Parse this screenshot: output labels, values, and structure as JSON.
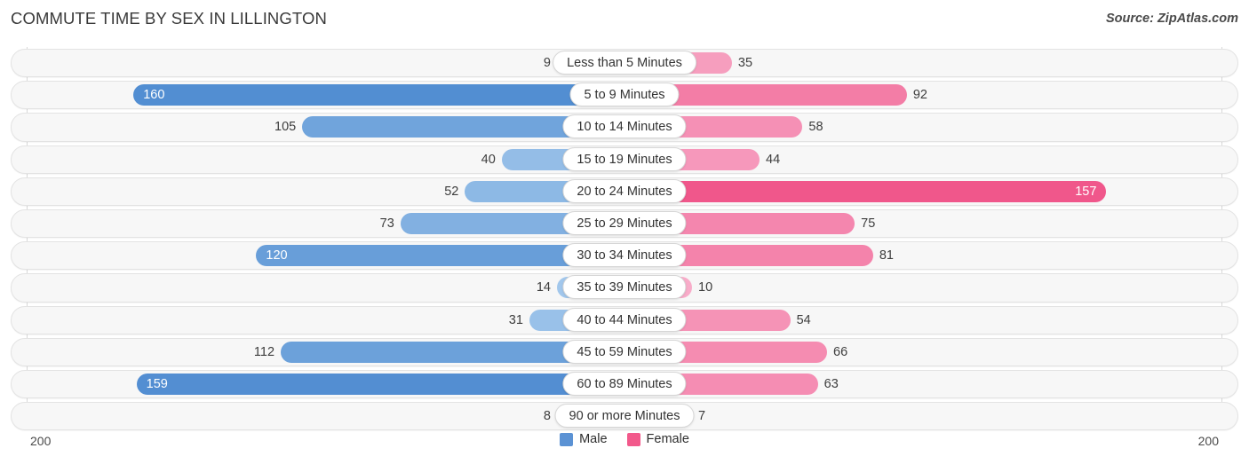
{
  "header": {
    "title": "COMMUTE TIME BY SEX IN LILLINGTON",
    "source": "Source: ZipAtlas.com"
  },
  "legend": {
    "items": [
      {
        "label": "Male",
        "color": "#5b92d4"
      },
      {
        "label": "Female",
        "color": "#f2598b"
      }
    ]
  },
  "axis": {
    "left_label": "200",
    "right_label": "200"
  },
  "chart_data": {
    "type": "bar",
    "title": "COMMUTE TIME BY SEX IN LILLINGTON",
    "subtitle": "Source: ZipAtlas.com",
    "orientation": "horizontal-diverging",
    "xlabel": "",
    "ylabel": "",
    "xlim": [
      200,
      200
    ],
    "axis_left_max": 200,
    "axis_right_max": 200,
    "grid": false,
    "legend_position": "bottom-center",
    "categories": [
      "Less than 5 Minutes",
      "5 to 9 Minutes",
      "10 to 14 Minutes",
      "15 to 19 Minutes",
      "20 to 24 Minutes",
      "25 to 29 Minutes",
      "30 to 34 Minutes",
      "35 to 39 Minutes",
      "40 to 44 Minutes",
      "45 to 59 Minutes",
      "60 to 89 Minutes",
      "90 or more Minutes"
    ],
    "series": [
      {
        "name": "Male",
        "color": "#5b92d4",
        "values": [
          9,
          160,
          105,
          40,
          52,
          73,
          120,
          14,
          31,
          112,
          159,
          8
        ]
      },
      {
        "name": "Female",
        "color": "#f2598b",
        "values": [
          35,
          92,
          58,
          44,
          157,
          75,
          81,
          10,
          54,
          66,
          63,
          7
        ]
      }
    ]
  },
  "rows": [
    {
      "category": "Less than 5 Minutes",
      "male": 9,
      "female": 35,
      "male_inside": false,
      "female_inside": false
    },
    {
      "category": "5 to 9 Minutes",
      "male": 160,
      "female": 92,
      "male_inside": true,
      "female_inside": false
    },
    {
      "category": "10 to 14 Minutes",
      "male": 105,
      "female": 58,
      "male_inside": false,
      "female_inside": false
    },
    {
      "category": "15 to 19 Minutes",
      "male": 40,
      "female": 44,
      "male_inside": false,
      "female_inside": false
    },
    {
      "category": "20 to 24 Minutes",
      "male": 52,
      "female": 157,
      "male_inside": false,
      "female_inside": true
    },
    {
      "category": "25 to 29 Minutes",
      "male": 73,
      "female": 75,
      "male_inside": false,
      "female_inside": false
    },
    {
      "category": "30 to 34 Minutes",
      "male": 120,
      "female": 81,
      "male_inside": true,
      "female_inside": false
    },
    {
      "category": "35 to 39 Minutes",
      "male": 14,
      "female": 10,
      "male_inside": false,
      "female_inside": false
    },
    {
      "category": "40 to 44 Minutes",
      "male": 31,
      "female": 54,
      "male_inside": false,
      "female_inside": false
    },
    {
      "category": "45 to 59 Minutes",
      "male": 112,
      "female": 66,
      "male_inside": false,
      "female_inside": false
    },
    {
      "category": "60 to 89 Minutes",
      "male": 159,
      "female": 63,
      "male_inside": true,
      "female_inside": false
    },
    {
      "category": "90 or more Minutes",
      "male": 8,
      "female": 7,
      "male_inside": false,
      "female_inside": false
    }
  ]
}
